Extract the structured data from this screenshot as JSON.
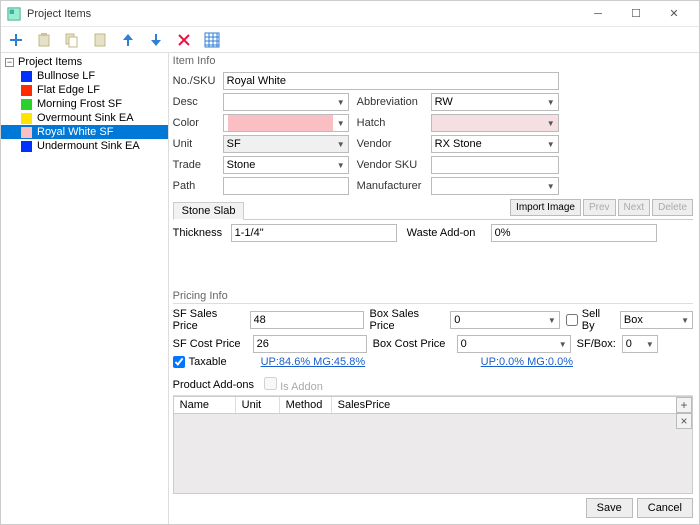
{
  "window": {
    "title": "Project Items"
  },
  "tree": {
    "root": "Project Items",
    "items": [
      {
        "label": "Bullnose  LF",
        "color": "#0030ff"
      },
      {
        "label": "Flat Edge  LF",
        "color": "#ff2a00"
      },
      {
        "label": "Morning Frost  SF",
        "color": "#2bd12b"
      },
      {
        "label": "Overmount Sink  EA",
        "color": "#ffe400"
      },
      {
        "label": "Royal White  SF",
        "color": "#f9bfc2",
        "selected": true
      },
      {
        "label": "Undermount Sink  EA",
        "color": "#0030ff"
      }
    ]
  },
  "itemInfo": {
    "header": "Item Info",
    "labels": {
      "nosku": "No./SKU",
      "desc": "Desc",
      "color": "Color",
      "unit": "Unit",
      "trade": "Trade",
      "path": "Path",
      "abbrev": "Abbreviation",
      "hatch": "Hatch",
      "vendor": "Vendor",
      "vendorsku": "Vendor SKU",
      "mfr": "Manufacturer"
    },
    "values": {
      "nosku": "Royal White",
      "desc": "",
      "colorHex": "#f9bfc2",
      "unit": "SF",
      "trade": "Stone",
      "path": "",
      "abbrev": "RW",
      "hatch": "",
      "vendor": "RX Stone",
      "vendorsku": "",
      "mfr": ""
    },
    "imgbtns": {
      "import": "Import Image",
      "prev": "Prev",
      "next": "Next",
      "delete": "Delete"
    }
  },
  "slab": {
    "tab": "Stone Slab",
    "thicknessLbl": "Thickness",
    "thickness": "1-1/4\"",
    "wasteLbl": "Waste Add-on",
    "waste": "0%"
  },
  "pricing": {
    "header": "Pricing Info",
    "labels": {
      "sfSales": "SF Sales Price",
      "sfCost": "SF Cost Price",
      "boxSales": "Box Sales Price",
      "boxCost": "Box Cost Price",
      "taxable": "Taxable",
      "sellby": "Sell By",
      "sfbox": "SF/Box:"
    },
    "values": {
      "sfSales": "48",
      "sfCost": "26",
      "boxSales": "0",
      "boxCost": "0",
      "sellby": "Box",
      "sfbox": "0",
      "taxable": true
    },
    "links": {
      "up1": "UP:84.6% MG:45.8%",
      "up2": "UP:0.0% MG:0.0%"
    }
  },
  "addons": {
    "header": "Product Add-ons",
    "isAddon": "Is Addon",
    "cols": {
      "name": "Name",
      "unit": "Unit",
      "method": "Method",
      "salesprice": "SalesPrice"
    }
  },
  "footer": {
    "save": "Save",
    "cancel": "Cancel"
  }
}
